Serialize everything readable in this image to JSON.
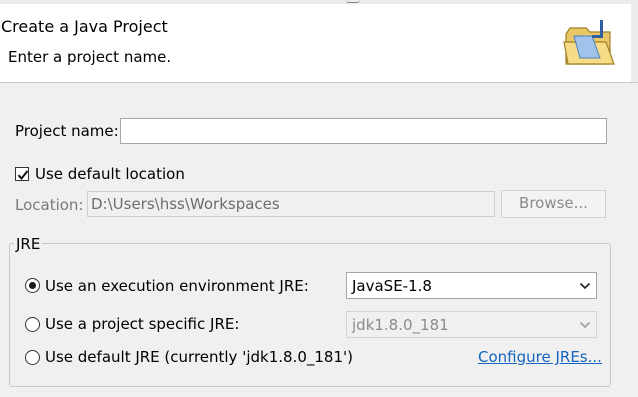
{
  "wizard": {
    "title": "Create a Java Project",
    "subtitle": "Enter a project name."
  },
  "project_name": {
    "label": "Project name:",
    "value": ""
  },
  "use_default_location": {
    "label": "Use default location",
    "checked": true
  },
  "location": {
    "label": "Location:",
    "value": "D:\\Users\\hss\\Workspaces",
    "browse_label": "Browse..."
  },
  "jre": {
    "group_label": "JRE",
    "options": [
      {
        "label": "Use an execution environment JRE:",
        "selected": true,
        "combo_value": "JavaSE-1.8"
      },
      {
        "label": "Use a project specific JRE:",
        "selected": false,
        "combo_value": "jdk1.8.0_181"
      },
      {
        "label": "Use default JRE (currently 'jdk1.8.0_181')",
        "selected": false
      }
    ],
    "configure_link": "Configure JREs..."
  },
  "colors": {
    "link": "#1565c0",
    "background": "#f0f0f0",
    "banner": "#ffffff"
  },
  "icons": {
    "banner": "new-java-project-folder-icon",
    "checkbox_check": "checkmark-icon",
    "combo_arrow": "chevron-down-icon"
  }
}
